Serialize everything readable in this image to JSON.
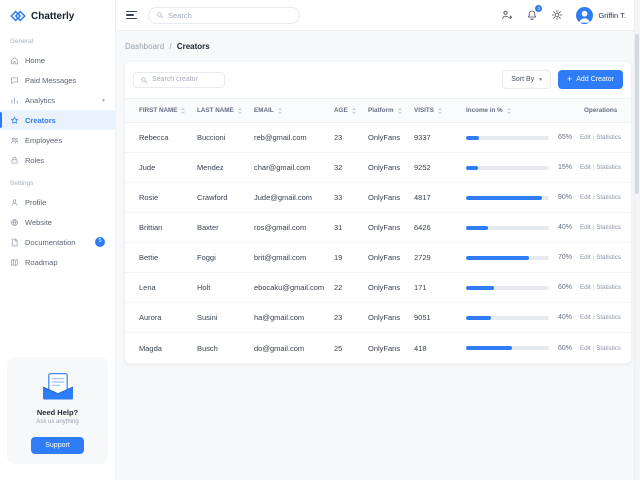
{
  "app": {
    "name": "Chatterly"
  },
  "topbar": {
    "search": {
      "placeholder": "Search"
    },
    "icons": [
      "user-export-icon",
      "bell-icon",
      "settings-gear-icon"
    ],
    "notifications": {
      "count": "3"
    },
    "user": {
      "name": "Griffin T."
    }
  },
  "sidebar": {
    "sections": [
      {
        "label": "General",
        "items": [
          {
            "label": "Home",
            "icon": "home"
          },
          {
            "label": "Paid Messages",
            "icon": "message"
          },
          {
            "label": "Analytics",
            "icon": "analytics",
            "chevron": true
          },
          {
            "label": "Creators",
            "icon": "creators",
            "active": true
          },
          {
            "label": "Employees",
            "icon": "employees"
          },
          {
            "label": "Roles",
            "icon": "roles"
          }
        ]
      },
      {
        "label": "Settings",
        "items": [
          {
            "label": "Profile",
            "icon": "profile"
          },
          {
            "label": "Website",
            "icon": "website"
          },
          {
            "label": "Documentation",
            "icon": "documentation",
            "badge": "5"
          },
          {
            "label": "Roadmap",
            "icon": "roadmap"
          }
        ]
      }
    ],
    "help": {
      "title": "Need Help?",
      "subtitle": "Ask us anything",
      "button_label": "Support"
    }
  },
  "breadcrumb": {
    "parent": "Dashboard",
    "separator": "/",
    "current": "Creators"
  },
  "toolbar": {
    "search_placeholder": "Search creator",
    "sort_by_label": "Sort By",
    "add_creator_label": "Add Creator"
  },
  "table": {
    "headers": [
      {
        "label": "FIRST NAME",
        "sortable": true
      },
      {
        "label": "LAST NAME",
        "sortable": true
      },
      {
        "label": "EMAIL",
        "sortable": true
      },
      {
        "label": "AGE",
        "sortable": true
      },
      {
        "label": "Platform",
        "sortable": true
      },
      {
        "label": "VISITS",
        "sortable": true
      },
      {
        "label": "Income in %",
        "sortable": true
      },
      {
        "label": "Operations",
        "sortable": false
      }
    ],
    "operations": {
      "edit_label": "Edit",
      "separator": "|",
      "statistics_label": "Statistics"
    },
    "rows": [
      {
        "first_name": "Rebecca",
        "last_name": "Buccioni",
        "email": "reb@gmail.com",
        "age": "23",
        "platform": "OnlyFans",
        "visits": "9337",
        "income_percent": "65%",
        "bar_fill_percent": 16
      },
      {
        "first_name": "Jude",
        "last_name": "Mendez",
        "email": "char@gmail.com",
        "age": "32",
        "platform": "OnlyFans",
        "visits": "9252",
        "income_percent": "15%",
        "bar_fill_percent": 15
      },
      {
        "first_name": "Rosie",
        "last_name": "Crawford",
        "email": "Jude@gmail.com",
        "age": "33",
        "platform": "OnlyFans",
        "visits": "4817",
        "income_percent": "90%",
        "bar_fill_percent": 92
      },
      {
        "first_name": "Brittian",
        "last_name": "Baxter",
        "email": "ros@gmail.com",
        "age": "31",
        "platform": "OnlyFans",
        "visits": "6426",
        "income_percent": "40%",
        "bar_fill_percent": 26
      },
      {
        "first_name": "Bettie",
        "last_name": "Foggi",
        "email": "brit@gmail.com",
        "age": "19",
        "platform": "OnlyFans",
        "visits": "2729",
        "income_percent": "70%",
        "bar_fill_percent": 76
      },
      {
        "first_name": "Lena",
        "last_name": "Holt",
        "email": "ebocaku@gmail.com",
        "age": "22",
        "platform": "OnlyFans",
        "visits": "171",
        "income_percent": "60%",
        "bar_fill_percent": 34
      },
      {
        "first_name": "Aurora",
        "last_name": "Susini",
        "email": "ha@gmail.com",
        "age": "23",
        "platform": "OnlyFans",
        "visits": "9051",
        "income_percent": "40%",
        "bar_fill_percent": 30
      },
      {
        "first_name": "Magda",
        "last_name": "Busch",
        "email": "do@gmail.com",
        "age": "25",
        "platform": "OnlyFans",
        "visits": "418",
        "income_percent": "60%",
        "bar_fill_percent": 56
      }
    ]
  },
  "colors": {
    "accent": "#2E7CF6",
    "accent_light": "#EAF2FE",
    "progress_track": "#E7EAEF"
  }
}
